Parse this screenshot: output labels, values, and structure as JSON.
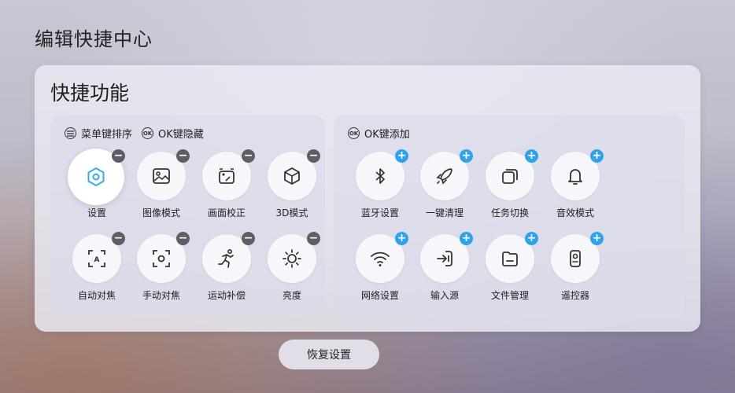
{
  "page": {
    "title": "编辑快捷中心"
  },
  "card": {
    "title": "快捷功能"
  },
  "left_panel": {
    "hint_menu_icon": "menu-icon",
    "hint_menu": "菜单键排序",
    "hint_ok_icon_text": "OK",
    "hint_ok": "OK键隐藏",
    "badge_symbol": "−",
    "tiles": [
      {
        "label": "设置",
        "icon": "settings-hex-icon",
        "focused": true
      },
      {
        "label": "图像模式",
        "icon": "image-icon"
      },
      {
        "label": "画面校正",
        "icon": "picture-correction-icon"
      },
      {
        "label": "3D模式",
        "icon": "cube-icon"
      },
      {
        "label": "自动对焦",
        "icon": "auto-focus-icon"
      },
      {
        "label": "手动对焦",
        "icon": "manual-focus-icon"
      },
      {
        "label": "运动补偿",
        "icon": "running-icon"
      },
      {
        "label": "亮度",
        "icon": "sun-icon"
      }
    ]
  },
  "right_panel": {
    "hint_ok_icon_text": "OK",
    "hint_ok": "OK键添加",
    "badge_symbol": "+",
    "tiles": [
      {
        "label": "蓝牙设置",
        "icon": "bluetooth-icon"
      },
      {
        "label": "一键清理",
        "icon": "rocket-icon"
      },
      {
        "label": "任务切换",
        "icon": "task-switch-icon"
      },
      {
        "label": "音效模式",
        "icon": "bell-icon"
      },
      {
        "label": "网络设置",
        "icon": "wifi-icon"
      },
      {
        "label": "输入源",
        "icon": "input-source-icon"
      },
      {
        "label": "文件管理",
        "icon": "folder-icon"
      },
      {
        "label": "遥控器",
        "icon": "remote-icon"
      }
    ]
  },
  "footer": {
    "restore_label": "恢复设置"
  },
  "colors": {
    "add_badge": "#2fa3ea",
    "remove_badge": "#5e5e66",
    "settings_accent": "#3aa8ee"
  }
}
